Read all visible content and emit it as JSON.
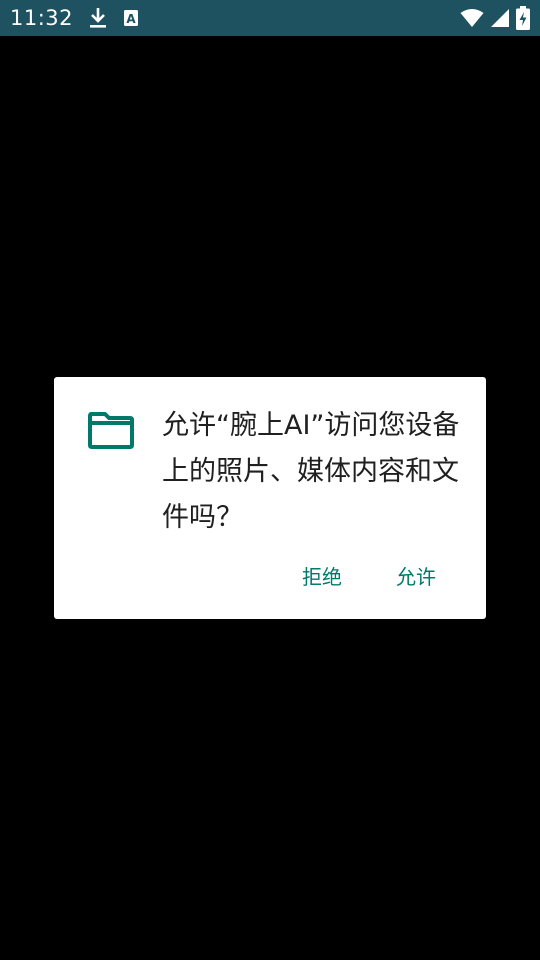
{
  "status_bar": {
    "time": "11:32",
    "icons": [
      "download-icon",
      "a-badge-icon",
      "wifi-icon",
      "signal-icon",
      "battery-charging-icon"
    ],
    "background": "#1f5261"
  },
  "dialog": {
    "icon": "folder-icon",
    "icon_color": "#00796b",
    "message": "允许“腕上AI”访问您设备上的照片、媒体内容和文件吗？",
    "deny_label": "拒绝",
    "allow_label": "允许",
    "button_color": "#00796b"
  }
}
